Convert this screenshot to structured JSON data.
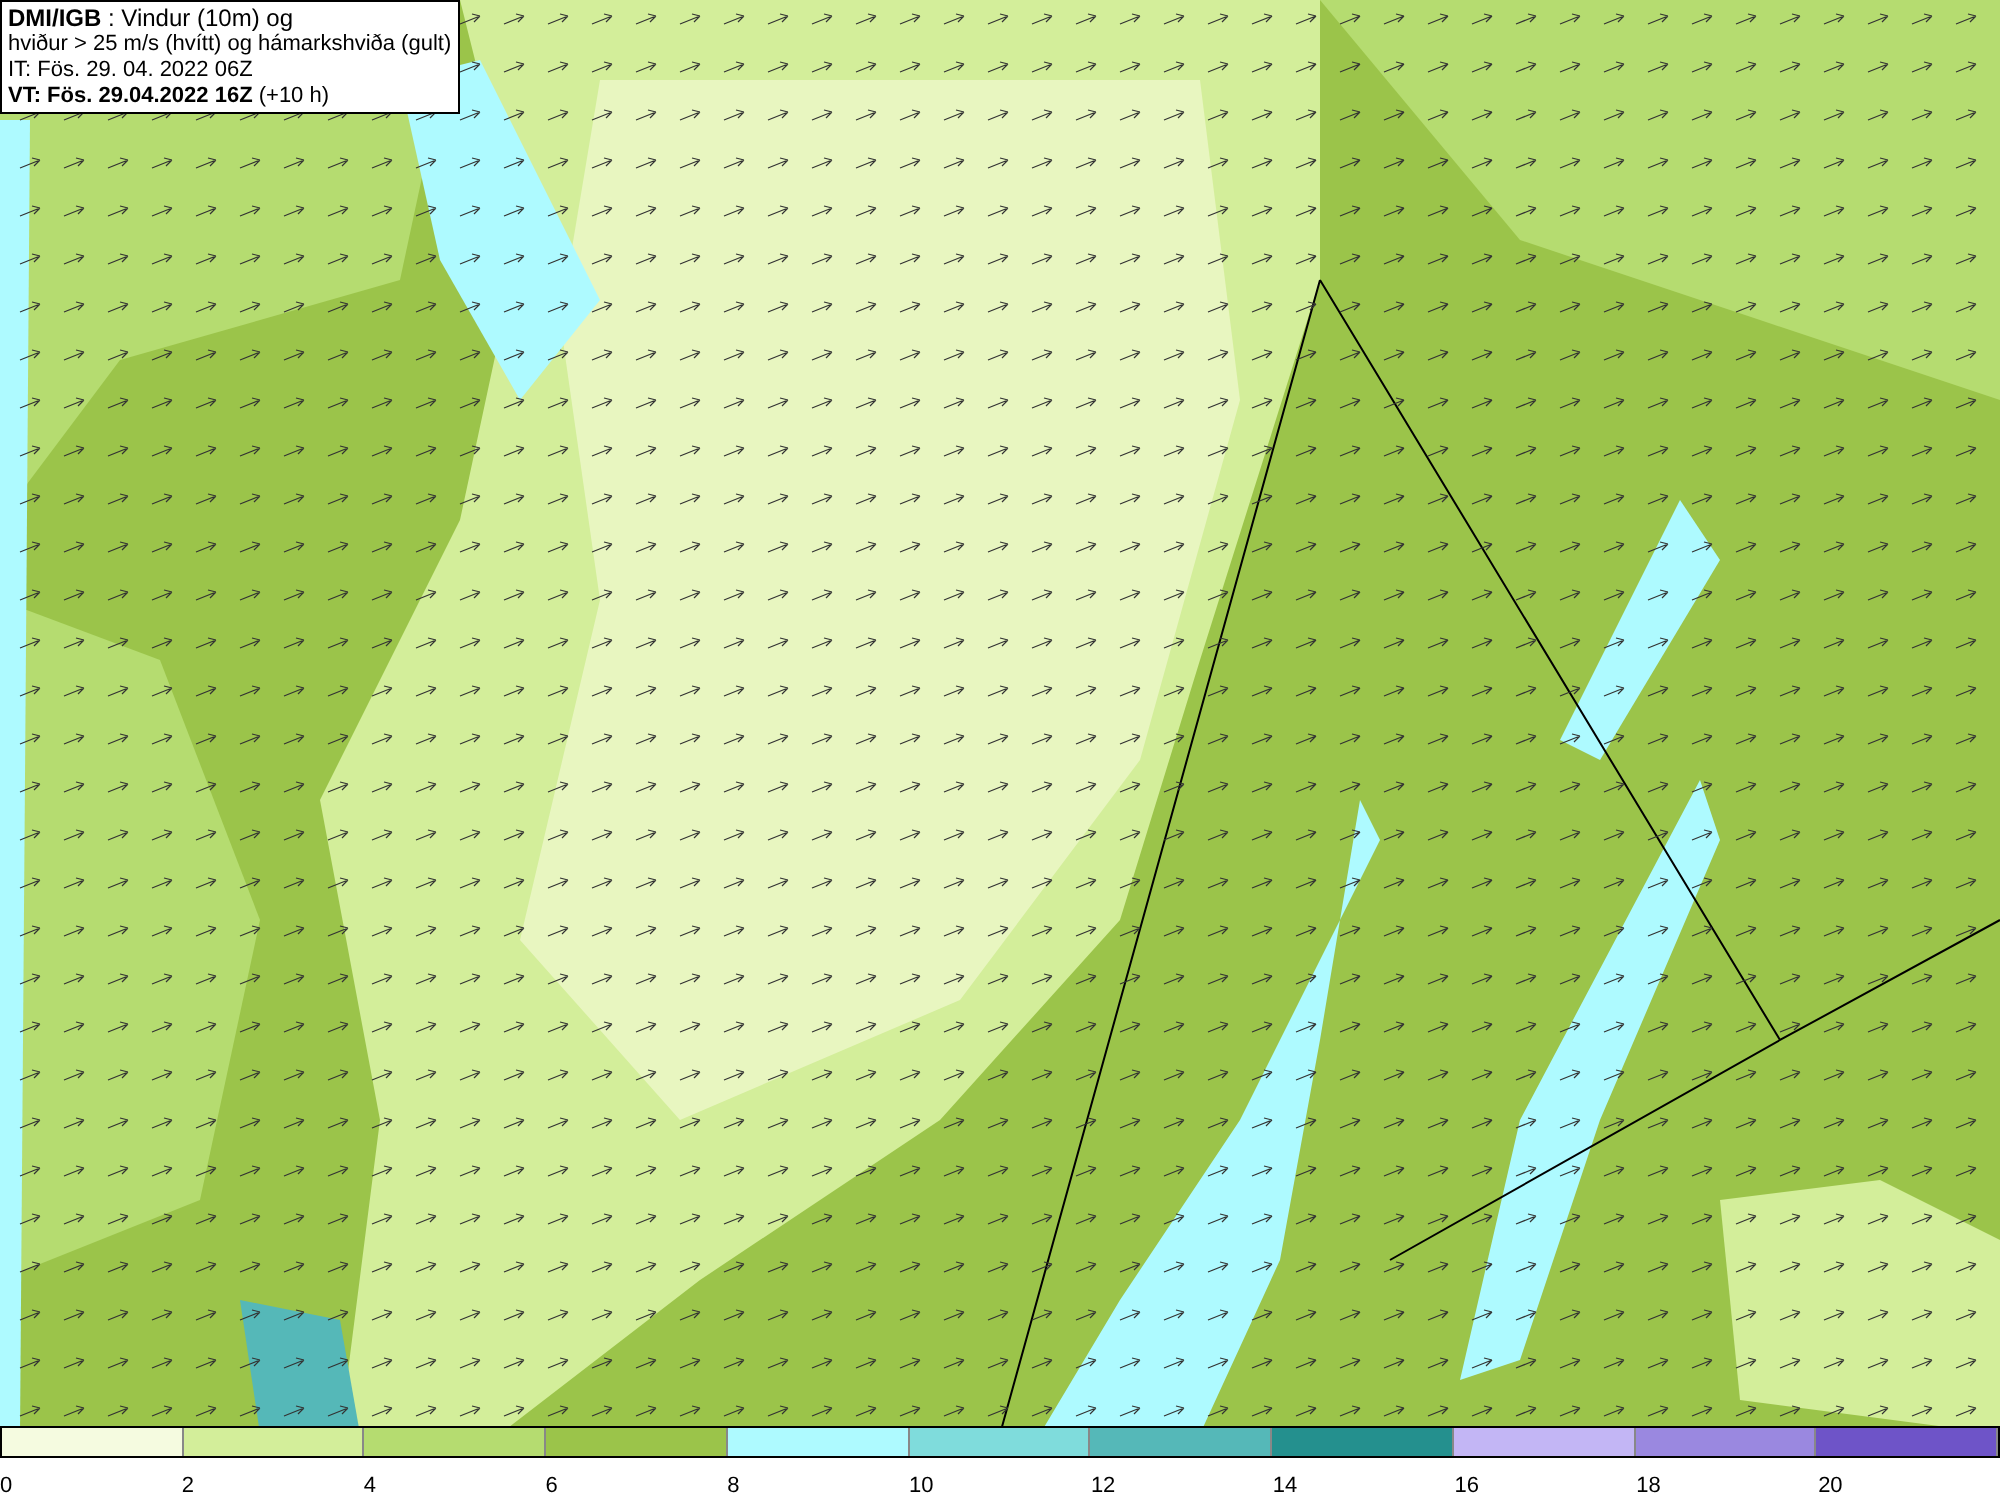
{
  "info_box": {
    "lines": [
      "**DMI/IGB** : Vindur (10m) og",
      "hviður > 25 m/s (hvítt) og hámarkshviða (gult)",
      "IT: Fös. 29. 04. 2022 06Z",
      "**VT: Fös. 29.04.2022 16Z** (+10 h)"
    ]
  },
  "legend": {
    "bins": [
      {
        "color": "#f5fbe0"
      },
      {
        "color": "#d3ee9a"
      },
      {
        "color": "#b5dc70"
      },
      {
        "color": "#9bc44a"
      },
      {
        "color": "#aefaff"
      },
      {
        "color": "#7fdcdc"
      },
      {
        "color": "#55b8b8"
      },
      {
        "color": "#24908e"
      },
      {
        "color": "#c3b6f5"
      },
      {
        "color": "#9a88e0"
      },
      {
        "color": "#6e54c8"
      }
    ],
    "ticks": [
      "0",
      "2",
      "4",
      "6",
      "8",
      "10",
      "12",
      "14",
      "16",
      "18",
      "20"
    ]
  }
}
